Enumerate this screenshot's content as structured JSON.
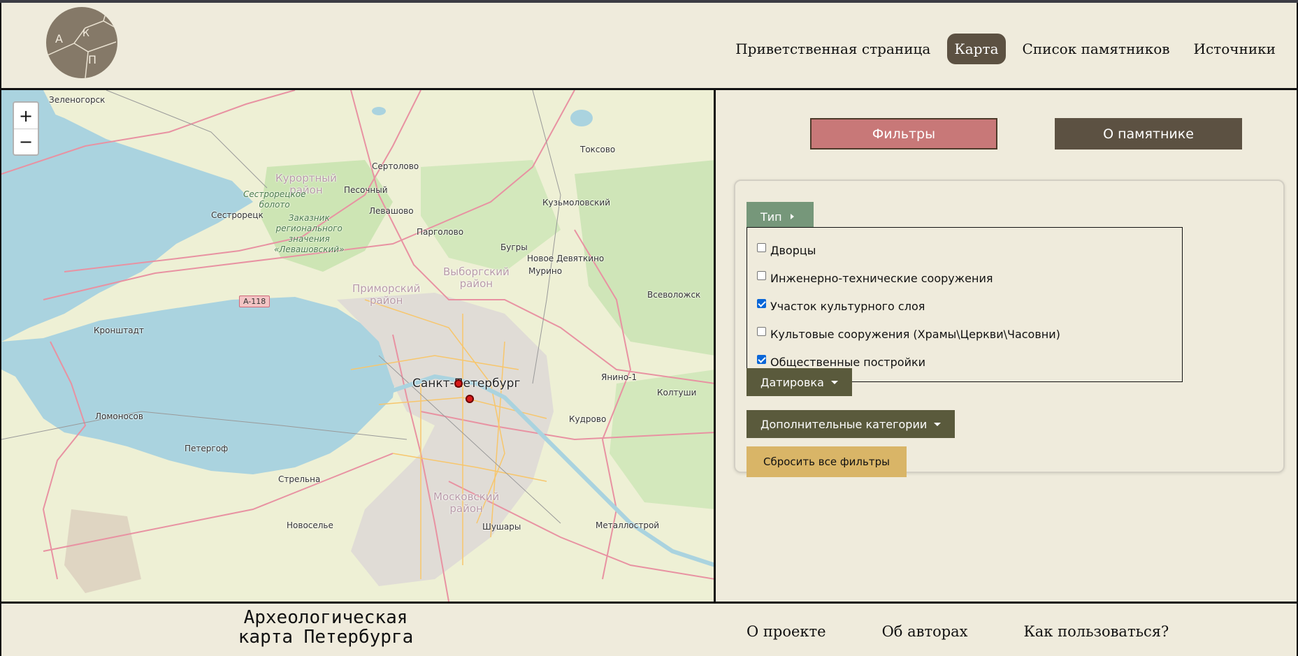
{
  "logo": {
    "letters": [
      "А",
      "К",
      "П"
    ]
  },
  "nav": {
    "items": [
      {
        "label": "Приветственная страница",
        "active": false
      },
      {
        "label": "Карта",
        "active": true
      },
      {
        "label": "Список памятников",
        "active": false
      },
      {
        "label": "Источники",
        "active": false
      }
    ]
  },
  "map": {
    "zoom_in": "+",
    "zoom_out": "−",
    "road_badge": "A-118",
    "labels": {
      "zelenogorsk": "Зеленогорск",
      "toksovo": "Токсово",
      "sertolovo": "Сертолово",
      "kurortny": "Курортный\nрайон",
      "sestroretskoe": "Сестрорецкое\nболото",
      "pesochny": "Песочный",
      "sestroretsk": "Сестрорецк",
      "levashovo": "Левашово",
      "zakaznik": "Заказник\nрегионального\nзначения\n«Левашовский»",
      "kuzmolovsky": "Кузьмоловский",
      "pargolovo": "Парголово",
      "bugry": "Бугры",
      "novoe_devyatkino": "Новое Девяткино",
      "murino": "Мурино",
      "vyborgsky": "Выборгский\nрайон",
      "primorsky": "Приморский\nрайон",
      "vsevolozhsk": "Всеволожск",
      "kronshtadt": "Кронштадт",
      "spb": "Санкт-Петербург",
      "yanino": "Янино-1",
      "koltushi": "Колтуши",
      "lomonosov": "Ломоносов",
      "kudrovo": "Кудрово",
      "petergof": "Петергоф",
      "strelna": "Стрельна",
      "moskovsky": "Московский\nрайон",
      "novoselye": "Новоселье",
      "shushary": "Шушары",
      "metallostroy": "Металлострой"
    },
    "marker_color": "#d81a1a"
  },
  "tabs": {
    "filters": "Фильтры",
    "about": "О памятнике"
  },
  "filters": {
    "type_label": "Тип",
    "options": [
      {
        "label": "Дворцы",
        "checked": false
      },
      {
        "label": "Инженерно-технические сооружения",
        "checked": false
      },
      {
        "label": "Участок культурного слоя",
        "checked": true
      },
      {
        "label": "Культовые сооружения (Храмы\\Церкви\\Часовни)",
        "checked": false
      },
      {
        "label": "Общественные постройки",
        "checked": true
      }
    ],
    "dating_label": "Датировка",
    "extra_label": "Дополнительные категории",
    "reset_label": "Сбросить все фильтры"
  },
  "footer": {
    "title": "Археологическая карта Петербурга",
    "links": [
      "О проекте",
      "Об авторах",
      "Как пользоваться?"
    ]
  },
  "colors": {
    "background": "#efebdc",
    "nav_active": "#5c5142",
    "filters_tab": "#c87878",
    "type_button": "#76977a",
    "dropdown": "#5a5a3c",
    "reset": "#d9b567"
  }
}
